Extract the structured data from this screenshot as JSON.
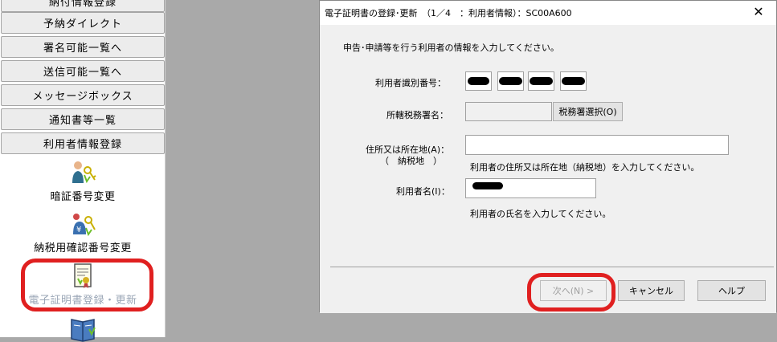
{
  "left_menu": {
    "buttons": [
      {
        "label": "納付情報登録"
      },
      {
        "label": "予納ダイレクト"
      },
      {
        "label": "署名可能一覧へ"
      },
      {
        "label": "送信可能一覧へ"
      },
      {
        "label": "メッセージボックス"
      },
      {
        "label": "通知書等一覧"
      },
      {
        "label": "利用者情報登録"
      }
    ],
    "icon_items": [
      {
        "label": "暗証番号変更",
        "icon": "key-person-icon"
      },
      {
        "label": "納税用確認番号変更",
        "icon": "key-yen-icon"
      },
      {
        "label": "電子証明書登録・更新",
        "icon": "certificate-icon",
        "state": "disabled"
      },
      {
        "label": "",
        "icon": "book-icon"
      }
    ]
  },
  "dialog": {
    "title": "電子証明書の登録･更新　（1／4　：利用者情報）：SC00A600",
    "instruction": "申告･申請等を行う利用者の情報を入力してください。",
    "fields": {
      "user_id_label": "利用者識別番号：",
      "tax_office_label": "所轄税務署名：",
      "tax_office_button": "税務署選択(O)",
      "address_label": "住所又は所在地(A)：",
      "address_sublabel": "（　納税地　）",
      "address_hint": "利用者の住所又は所在地（納税地）を入力してください。",
      "name_label": "利用者名(I)：",
      "name_hint": "利用者の氏名を入力してください。"
    },
    "buttons": {
      "next": "次へ(N) >",
      "cancel": "キャンセル",
      "help": "ヘルプ"
    },
    "close": "✕"
  },
  "colors": {
    "annotation_red": "#e02020",
    "disabled_text": "#9aa6b6"
  }
}
